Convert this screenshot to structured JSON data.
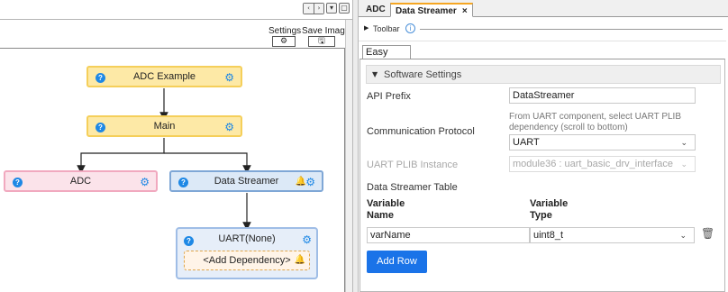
{
  "left": {
    "window_controls": {
      "prev": "‹",
      "next": "›",
      "menu": "▾",
      "restore": "▢"
    },
    "settings_label": "Settings",
    "save_image_label": "Save Image",
    "settings_icon": "⚙",
    "save_image_icon": "🖫",
    "nodes": {
      "adc_example": "ADC Example",
      "main": "Main",
      "adc": "ADC",
      "data_streamer": "Data Streamer",
      "uart": "UART(None)",
      "add_dependency": "<Add Dependency>"
    },
    "icons": {
      "help": "?",
      "gear": "⚙",
      "bell": "🔔"
    }
  },
  "right": {
    "tabs": [
      {
        "label": "ADC"
      },
      {
        "label": "Data Streamer",
        "close": "×"
      }
    ],
    "toolbar_label": "Toolbar",
    "toolbar_info": "i",
    "easy_view_tab": "Easy View",
    "section_title": "Software Settings",
    "fields": {
      "api_prefix_label": "API Prefix",
      "api_prefix_value": "DataStreamer",
      "comm_protocol_label": "Communication Protocol",
      "comm_protocol_hint": "From UART component, select UART PLIB dependency (scroll to bottom)",
      "comm_protocol_value": "UART",
      "uart_plib_label": "UART PLIB Instance",
      "uart_plib_value": "module36 : uart_basic_drv_interface",
      "table_label": "Data Streamer Table"
    },
    "table": {
      "col_name": "Variable Name",
      "col_type": "Variable Type",
      "rows": [
        {
          "name": "varName",
          "type": "uint8_t"
        }
      ]
    },
    "add_row_label": "Add Row",
    "trash_icon": "🗑",
    "chevron": "⌄"
  }
}
